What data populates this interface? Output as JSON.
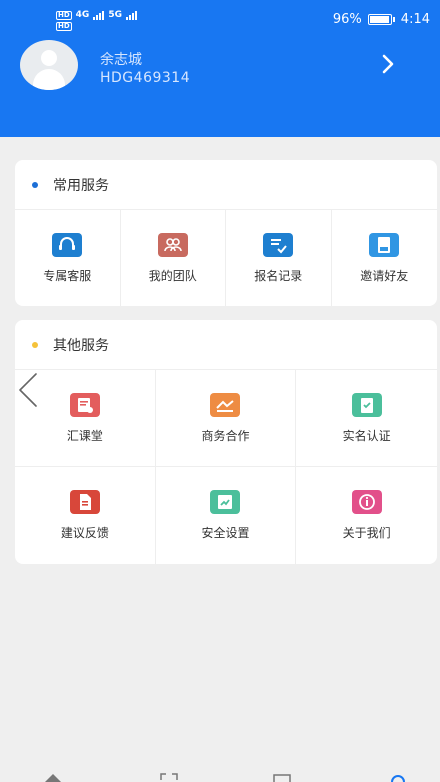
{
  "status_bar": {
    "hd1": "HD",
    "hd2": "HD",
    "net1": "4G",
    "net2": "5G",
    "battery": "96%",
    "battery_level": 0.96,
    "time": "4:14"
  },
  "profile": {
    "name": "余志城",
    "id": "HDG469314",
    "avatar_icon": "user-avatar-icon",
    "arrow_icon": "chevron-right-icon"
  },
  "common_services": {
    "title": "常用服务",
    "dot_color": "#1c6fd6",
    "items": [
      {
        "label": "专属客服",
        "icon": "headset-icon",
        "color": "#1e7fd0"
      },
      {
        "label": "我的团队",
        "icon": "team-icon",
        "color": "#c86a5f"
      },
      {
        "label": "报名记录",
        "icon": "record-icon",
        "color": "#1e7fd0"
      },
      {
        "label": "邀请好友",
        "icon": "invite-icon",
        "color": "#3096e3"
      }
    ]
  },
  "other_services": {
    "title": "其他服务",
    "dot_color": "#f5c23a",
    "items": [
      {
        "label": "汇课堂",
        "icon": "classroom-icon",
        "color": "#e35d5d"
      },
      {
        "label": "商务合作",
        "icon": "cooperation-icon",
        "color": "#ee8c43"
      },
      {
        "label": "实名认证",
        "icon": "verify-icon",
        "color": "#4bbf9b"
      },
      {
        "label": "建议反馈",
        "icon": "feedback-icon",
        "color": "#d8473a"
      },
      {
        "label": "安全设置",
        "icon": "security-icon",
        "color": "#4bbf9b"
      },
      {
        "label": "关于我们",
        "icon": "info-icon",
        "color": "#e2508a"
      }
    ]
  },
  "colors": {
    "header": "#1877f2",
    "background": "#efefef"
  }
}
